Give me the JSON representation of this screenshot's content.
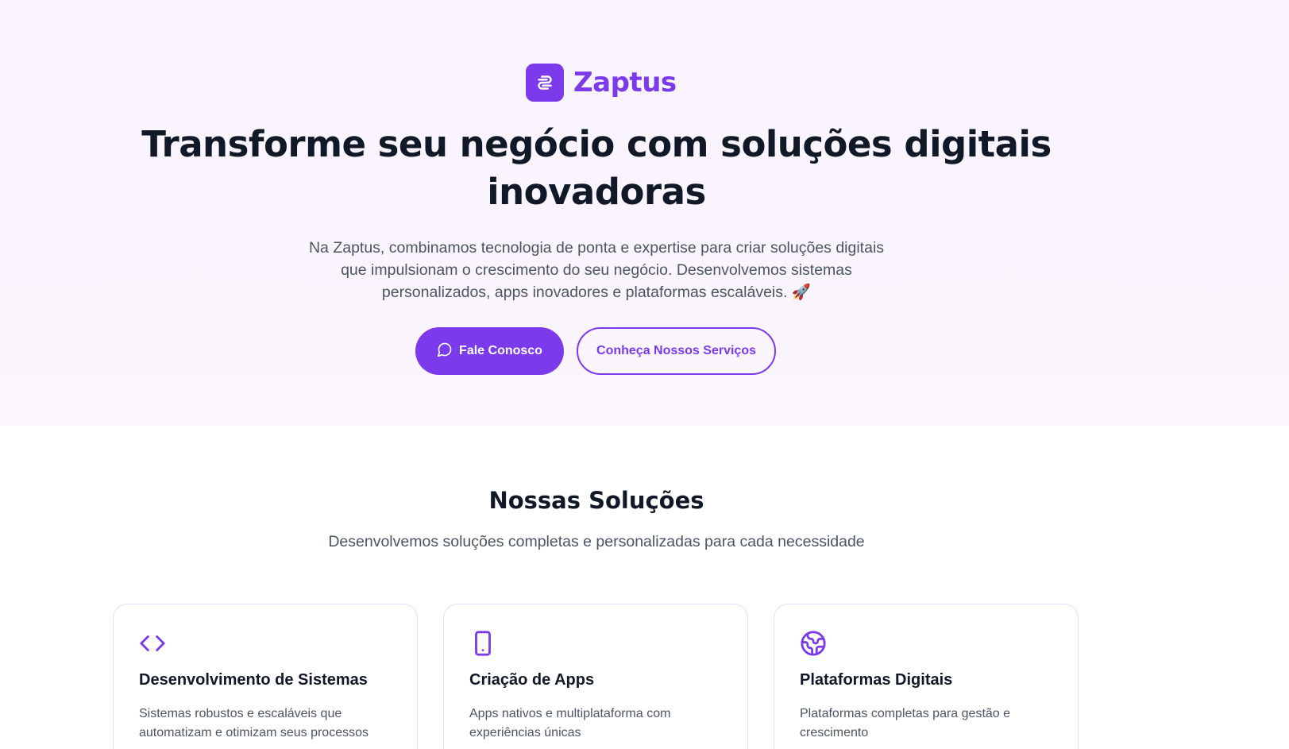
{
  "brand": {
    "name": "Zaptus",
    "accent_color": "#7c3aed",
    "logo_icon": "link-chain-icon"
  },
  "hero": {
    "title": "Transforme seu negócio com soluções digitais inovadoras",
    "description": "Na Zaptus, combinamos tecnologia de ponta e expertise para criar soluções digitais que impulsionam o crescimento do seu negócio. Desenvolvemos sistemas personalizados, apps inovadores e plataformas escaláveis. 🚀",
    "primary_button": {
      "label": "Fale Conosco",
      "icon": "chat-bubble-icon"
    },
    "secondary_button": {
      "label": "Conheça Nossos Serviços"
    }
  },
  "solutions": {
    "title": "Nossas Soluções",
    "subtitle": "Desenvolvemos soluções completas e personalizadas para cada necessidade",
    "cards": [
      {
        "icon": "code-icon",
        "title": "Desenvolvimento de Sistemas",
        "description": "Sistemas robustos e escaláveis que automatizam e otimizam seus processos"
      },
      {
        "icon": "smartphone-icon",
        "title": "Criação de Apps",
        "description": "Apps nativos e multiplataforma com experiências únicas"
      },
      {
        "icon": "globe-icon",
        "title": "Plataformas Digitais",
        "description": "Plataformas completas para gestão e crescimento"
      }
    ]
  }
}
